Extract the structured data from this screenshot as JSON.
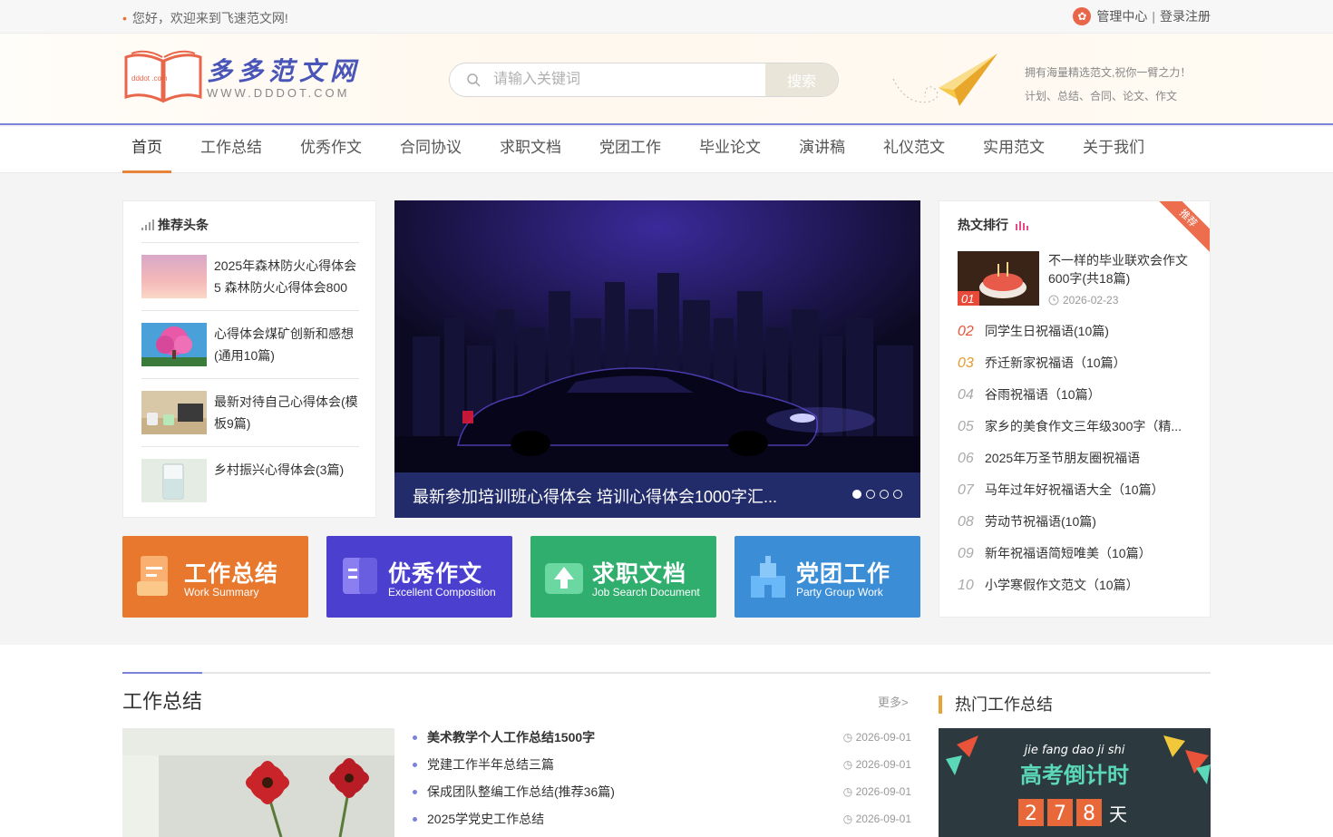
{
  "topbar": {
    "welcome": "您好，欢迎来到飞速范文网!",
    "admin_label": "管理中心",
    "separator": "|",
    "login_label": "登录注册"
  },
  "header": {
    "logo_text": "多多范文网",
    "logo_url": "WWW.DDDOT.COM",
    "logo_badge": "dddot .com",
    "search_placeholder": "请输入关键词",
    "search_button": "搜索",
    "slogan_line1": "拥有海量精选范文,祝你一臂之力！",
    "slogan_line2": "计划、总结、合同、论文、作文"
  },
  "nav": {
    "items": [
      "首页",
      "工作总结",
      "优秀作文",
      "合同协议",
      "求职文档",
      "党团工作",
      "毕业论文",
      "演讲稿",
      "礼仪范文",
      "实用范文",
      "关于我们"
    ]
  },
  "recommend": {
    "title": "推荐头条",
    "items": [
      {
        "title": "2025年森林防火心得体会5 森林防火心得体会800"
      },
      {
        "title": "心得体会煤矿创新和感想(通用10篇)"
      },
      {
        "title": "最新对待自己心得体会(模板9篇)"
      },
      {
        "title": "乡村振兴心得体会(3篇)"
      }
    ]
  },
  "banner": {
    "caption": "最新参加培训班心得体会 培训心得体会1000字汇..."
  },
  "tiles": [
    {
      "name": "工作总结",
      "sub": "Work Summary",
      "color": "#e8782e"
    },
    {
      "name": "优秀作文",
      "sub": "Excellent Composition",
      "color": "#4b3fd0"
    },
    {
      "name": "求职文档",
      "sub": "Job Search Document",
      "color": "#2fae6e"
    },
    {
      "name": "党团工作",
      "sub": "Party Group Work",
      "color": "#3b8ed6"
    }
  ],
  "hot": {
    "title": "热文排行",
    "ribbon": "推荐",
    "first": {
      "num": "01",
      "title": "不一样的毕业联欢会作文600字(共18篇)",
      "date": "2026-02-23"
    },
    "rows": [
      {
        "num": "02",
        "title": "同学生日祝福语(10篇)"
      },
      {
        "num": "03",
        "title": "乔迁新家祝福语（10篇）"
      },
      {
        "num": "04",
        "title": "谷雨祝福语（10篇）"
      },
      {
        "num": "05",
        "title": "家乡的美食作文三年级300字（精..."
      },
      {
        "num": "06",
        "title": "2025年万圣节朋友圈祝福语"
      },
      {
        "num": "07",
        "title": "马年过年好祝福语大全（10篇）"
      },
      {
        "num": "08",
        "title": "劳动节祝福语(10篇)"
      },
      {
        "num": "09",
        "title": "新年祝福语简短唯美（10篇）"
      },
      {
        "num": "10",
        "title": "小学寒假作文范文（10篇）"
      }
    ]
  },
  "section": {
    "title": "工作总结",
    "more": "更多>",
    "hot_title": "热门工作总结",
    "items": [
      {
        "title": "美术教学个人工作总结1500字",
        "date": "2026-09-01"
      },
      {
        "title": "党建工作半年总结三篇",
        "date": "2026-09-01"
      },
      {
        "title": "保成团队整编工作总结(推荐36篇)",
        "date": "2026-09-01"
      },
      {
        "title": "2025学党史工作总结",
        "date": "2026-09-01"
      }
    ],
    "countdown": {
      "pinyin": "jie fang dao ji shi",
      "title": "高考倒计时",
      "digits": [
        "2",
        "7",
        "8"
      ],
      "unit": "天"
    }
  }
}
